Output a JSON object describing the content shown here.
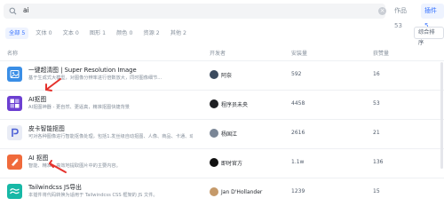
{
  "search": {
    "value": "ai",
    "scope_tabs": [
      {
        "label": "作品 53"
      },
      {
        "label": "插件 5"
      }
    ]
  },
  "filters": {
    "chips": [
      {
        "label": "全部 5"
      },
      {
        "label": "文体 0"
      },
      {
        "label": "文本 0"
      },
      {
        "label": "图形 1"
      },
      {
        "label": "颜色 0"
      },
      {
        "label": "资源 2"
      },
      {
        "label": "其他 2"
      }
    ],
    "sort_label": "综合排序"
  },
  "table": {
    "headers": {
      "name": "名称",
      "developer": "开发者",
      "installs": "安装量",
      "likes": "获赞量"
    },
    "rows": [
      {
        "title": "一键超清图 | Super Resolution Image",
        "desc": "基于生成式大模型，对图像分辨率进行倍数放大，同时图像细节...",
        "developer": "阿奈",
        "installs": "592",
        "likes": "16",
        "icon": "image-enhance-icon",
        "icon_color": "#3a8ee6"
      },
      {
        "title": "AI抠图",
        "desc": "AI抠图神器 - 更自然、更逼真，精准抠图快捷背景",
        "developer": "程序员未央",
        "installs": "4458",
        "likes": "53",
        "icon": "grid-icon",
        "icon_color": "#6c3fd1"
      },
      {
        "title": "皮卡智能抠图",
        "desc": "可对各种图像进行智能抠像处理，包括1.发丝级自动抠图、人像、商品、卡通、动物...",
        "developer": "杨国江",
        "installs": "2616",
        "likes": "21",
        "icon": "pika-icon",
        "icon_color": "#e9ecf5"
      },
      {
        "title": "AI 抠图",
        "desc": "智能、精准、高效地提取图片中的主要内容。",
        "developer": "即时官方",
        "installs": "1.1w",
        "likes": "136",
        "icon": "cutout-icon",
        "icon_color": "#f06a3b"
      },
      {
        "title": "Tailwindcss JS导出",
        "desc": "本插件将代码转换为适用于 Tailwindcss CSS 框架的 JS 文件。",
        "developer": "Jan D'Hollander",
        "installs": "1239",
        "likes": "15",
        "icon": "tailwind-icon",
        "icon_color": "#17b8a6"
      }
    ]
  },
  "colors": {
    "accent": "#3370ff",
    "annotation": "#e5322d"
  }
}
